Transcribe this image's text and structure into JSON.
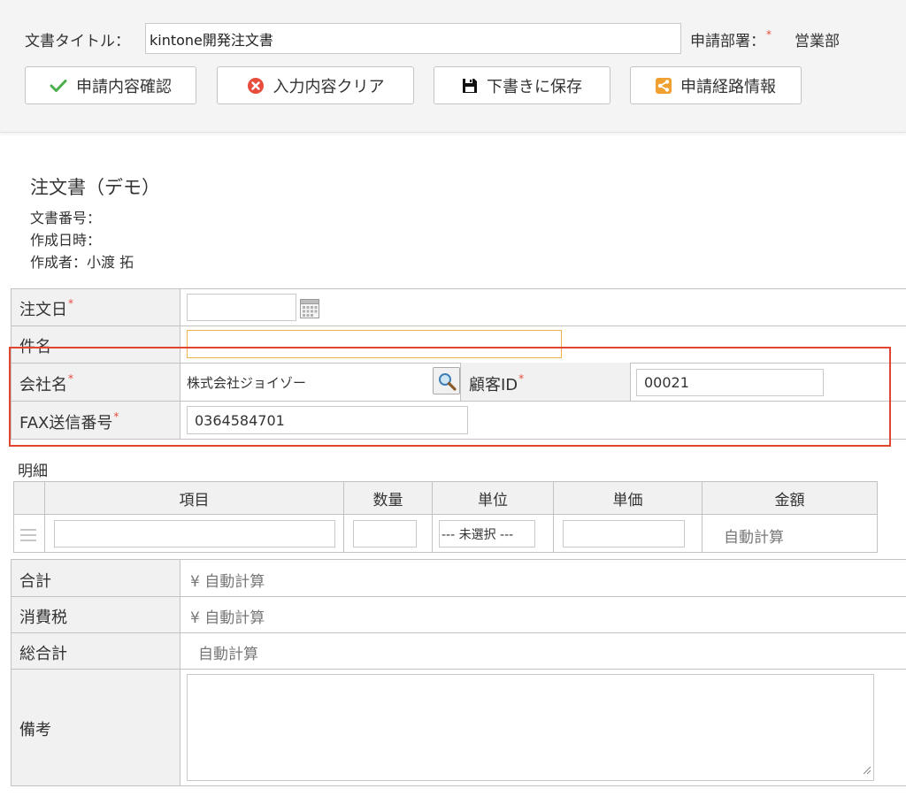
{
  "header": {
    "doc_title_label": "文書タイトル：",
    "doc_title_value": "kintone開発注文書",
    "dept_label": "申請部署：",
    "required_mark": "*",
    "dept_value": "営業部"
  },
  "toolbar": {
    "confirm_label": "申請内容確認",
    "clear_label": "入力内容クリア",
    "save_draft_label": "下書きに保存",
    "route_label": "申請経路情報"
  },
  "colors": {
    "check_green": "#4cae4c",
    "clear_red": "#e74c3c",
    "route_orange": "#f0a030",
    "highlight_red": "#e0452f"
  },
  "form": {
    "title": "注文書（デモ）",
    "doc_number_label": "文書番号：",
    "created_at_label": "作成日時：",
    "author_label": "作成者：小渡 拓"
  },
  "fields": {
    "order_date_label": "注文日",
    "subject_label": "件名",
    "company_label": "会社名",
    "company_value": "株式会社ジョイゾー",
    "customer_id_label": "顧客ID",
    "customer_id_value": "00021",
    "fax_label": "FAX送信番号",
    "fax_value": "0364584701"
  },
  "details": {
    "section_label": "明細",
    "headers": [
      "項目",
      "数量",
      "単位",
      "単価",
      "金額"
    ],
    "unit_select_value": "--- 未選択 ---",
    "amount_value": "自動計算"
  },
  "totals": {
    "subtotal_label": "合計",
    "subtotal_value": "¥ 自動計算",
    "tax_label": "消費税",
    "tax_value": "¥ 自動計算",
    "grand_total_label": "総合計",
    "grand_total_value": "自動計算",
    "remarks_label": "備考"
  }
}
